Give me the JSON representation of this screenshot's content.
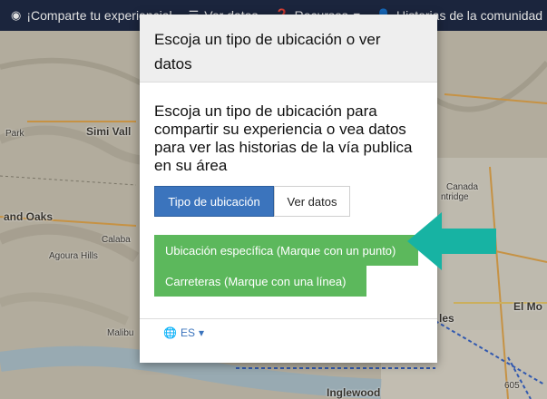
{
  "nav": {
    "items": [
      {
        "icon": "map-marker-icon",
        "label": "¡Comparte tu experiencial"
      },
      {
        "icon": "list-icon",
        "label": "Ver datos"
      },
      {
        "icon": "question-icon",
        "label": "Recursos"
      },
      {
        "icon": "person-icon",
        "label": "Historias de la comunidad"
      }
    ]
  },
  "map": {
    "labels": {
      "simi_valley": "Simi Vall",
      "park": "Park",
      "thousand_oaks": "and Oaks",
      "calabasas": "Calaba",
      "agoura_hills": "Agoura Hills",
      "malibu": "Malibu",
      "canada": "Canada",
      "flintridge": "ntridge",
      "el_monte": "El Mo",
      "angeles": "les",
      "inglewood": "Inglewood",
      "route": "605"
    }
  },
  "modal": {
    "title": "Escoja un tipo de ubicación o ver datos",
    "prompt": "Escoja un tipo de ubicación para compartir su experiencia o vea datos para ver las historias de la vía publica en su área",
    "tabs": {
      "location_type": "Tipo de ubicación",
      "view_data": "Ver datos"
    },
    "options": {
      "point": "Ubicación específica (Marque con un punto)",
      "line": "Carreteras (Marque con una línea)"
    },
    "language": "ES"
  },
  "colors": {
    "nav_bg": "#1f2b46",
    "primary": "#3b74bd",
    "success": "#5cb85c",
    "arrow": "#17b3a3"
  }
}
